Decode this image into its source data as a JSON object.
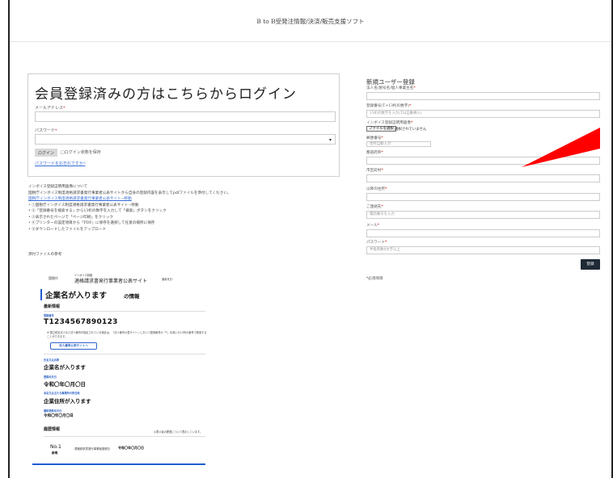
{
  "header": {
    "title": "B to B受発注情報/決済/販売支援ソフト"
  },
  "login": {
    "title": "会員登録済みの方はこちらからログイン",
    "email_label": "メールアドレス",
    "password_label": "パスワード",
    "required_mark": "*",
    "login_button": "ログイン",
    "remember_label": "□ログイン状態を保存",
    "forgot_link": "パスワードをお忘れですか?"
  },
  "notes": {
    "heading": "インボイス登録証明用画像について",
    "desc": "国税庁インボイス制度適格請求書発行事業者公表サイトから自身の登録内容を表示してpdfファイルを添付してください。",
    "link": "国税庁インボイス制度適格請求書発行事業者公表サイト→移動",
    "steps": [
      "①国税庁インボイス制度適格請求書発行事業者公表サイト→移動",
      "②「登録番号を検索する」から13桁の数字を入力して「検索」ボタンをクリック",
      "③表示されたページで「ページ印刷」をクリック",
      "④プリンターの設定項目から「PDF」に保存を選択して任意の場所に保存",
      "⑤ダウンロードしたファイルをアップロード"
    ],
    "ref_title": "添付ファイルの参考"
  },
  "sample": {
    "left_label": "国税庁",
    "site_small": "インボイス制度",
    "site": "適格請求書発行事業者公表サイト",
    "right_label": "適用月日：",
    "company": "企業名が入ります",
    "info_suffix": "の情報",
    "latest": "最新情報",
    "reg_no_cap": "登録番号",
    "reg_no": "T1234567890123",
    "note": "※ 国立税定法人など法人番号が指定されている場合は、「法人番号公表サイト」において登録番号の「T」を除いた13桁の番号で検索することができます。",
    "corp_btn": "法人番号公表サイトへ",
    "name_cap": "氏名又は名称",
    "name": "企業名が入ります",
    "date_cap": "登録年月日",
    "date": "令和〇年〇月〇日",
    "addr_cap": "本店又は主たる事務所の所在地",
    "addr": "企業住所が入ります",
    "update_cap": "最終更新年月日",
    "update": "令和〇年〇月〇日",
    "history": "履歴情報",
    "history_note": "公表以後の履歴について表示しています。",
    "no": "No.1",
    "no_sub": "新規",
    "row_mid": "適格請求書発行事業者登録日",
    "row_right": "令和〇年〇月〇日"
  },
  "register": {
    "title": "新規ユーザー登録",
    "company_label": "法人名/屋号名/個人事業主名",
    "reg_no_label": "登録番号(T+13桁の数字)",
    "reg_no_placeholder": "13桁の数字を入力(Tは自動挿入)",
    "invoice_label": "インボイス登録証明用画像",
    "file_button": "ファイルを選択",
    "file_status": "選択されていません",
    "zip_label": "郵便番号",
    "zip_placeholder": "住所自動入力",
    "pref_label": "都道府県",
    "city_label": "市区町村",
    "addr_label": "以降の住所",
    "phone_label": "ご連絡先",
    "phone_placeholder": "電話番号を入力",
    "mail_label": "メール",
    "password_label": "パスワード",
    "password_placeholder": "半角英数8文字以上",
    "required_mark": "*",
    "submit": "登録",
    "required_note": "*必須項目"
  },
  "colors": {
    "accent": "#1e5ed0",
    "required": "#dd0000",
    "button_dark": "#1f2a36",
    "annotation": "#ff0000"
  }
}
